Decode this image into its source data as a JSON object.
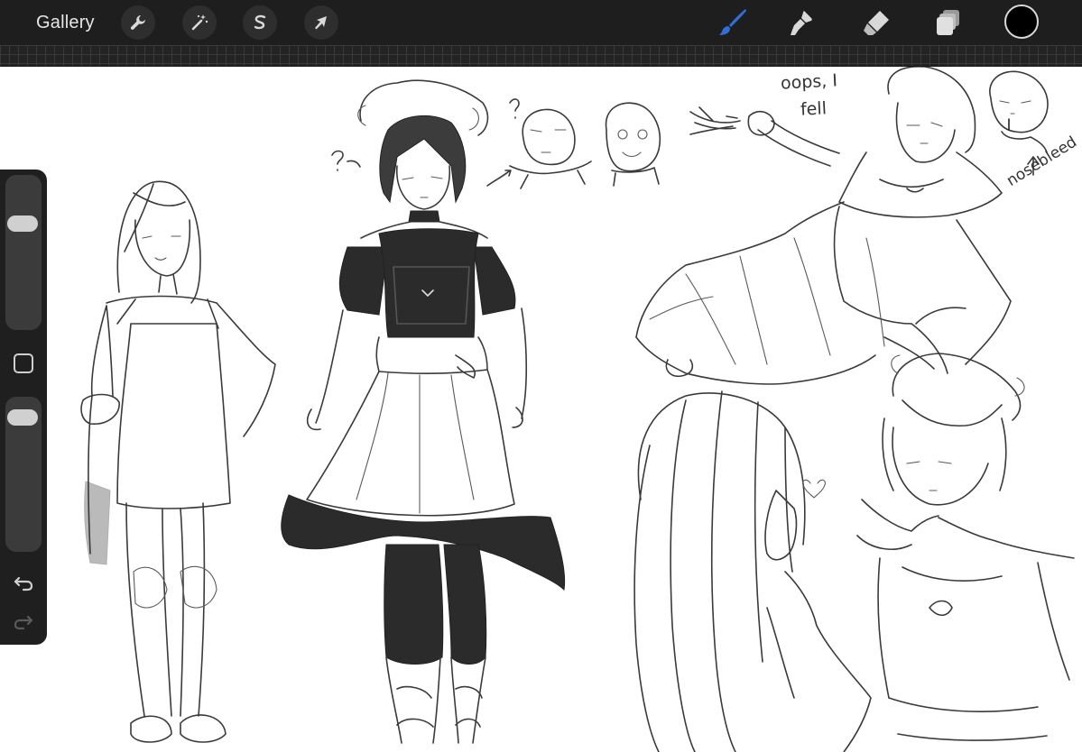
{
  "toolbar": {
    "gallery_label": "Gallery",
    "left_tools": [
      "wrench-icon",
      "magic-wand-icon",
      "selection-icon",
      "transform-arrow-icon"
    ],
    "right_tools": [
      "brush-icon",
      "smudge-icon",
      "eraser-icon",
      "layers-icon"
    ],
    "active_tool": "brush",
    "active_tool_color": "#2f6fd6",
    "current_color": "#000000"
  },
  "sidebar": {
    "brush_size_level": 0.72,
    "opacity_level": 0.93,
    "modify_icon": "square-icon",
    "undo_icon": "undo-arrow-icon",
    "redo_icon": "redo-arrow-icon"
  },
  "canvas": {
    "annotations": {
      "oops_line1": "oops, I",
      "oops_line2": "fell",
      "nosebleed": "nosebleed"
    }
  }
}
